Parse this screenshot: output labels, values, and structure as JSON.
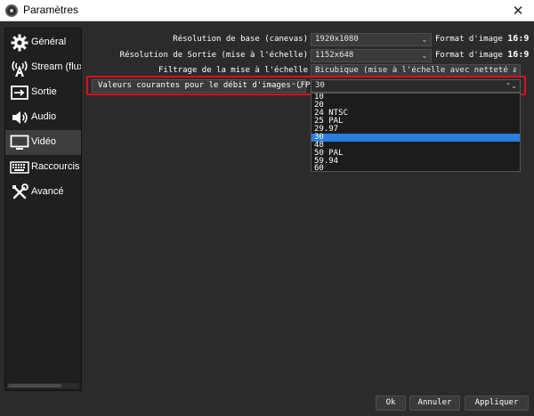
{
  "window": {
    "title": "Paramètres",
    "close_glyph": "✕"
  },
  "sidebar": {
    "items": [
      {
        "label": "Général",
        "icon": "gear-icon"
      },
      {
        "label": "Stream (flux)",
        "icon": "antenna-icon"
      },
      {
        "label": "Sortie",
        "icon": "output-icon"
      },
      {
        "label": "Audio",
        "icon": "speaker-icon"
      },
      {
        "label": "Vidéo",
        "icon": "monitor-icon",
        "active": true
      },
      {
        "label": "Raccourcis cl",
        "icon": "keyboard-icon"
      },
      {
        "label": "Avancé",
        "icon": "tools-icon"
      }
    ]
  },
  "video": {
    "base_resolution": {
      "label": "Résolution de base (canevas)",
      "value": "1920x1080",
      "aspect": "Format d'image",
      "aspect_value": "16:9"
    },
    "output_resolution": {
      "label": "Résolution de Sortie (mise à l'échelle)",
      "value": "1152x648",
      "aspect": "Format d'image",
      "aspect_value": "16:9"
    },
    "downscale_filter": {
      "label": "Filtrage de la mise à l'échelle",
      "value": "Bicubique (mise à l'échelle avec netteté acc"
    },
    "fps": {
      "type_label": "Valeurs courantes pour le débit d'images (FPS)",
      "value": "30",
      "options": [
        "10",
        "20",
        "24 NTSC",
        "25 PAL",
        "29.97",
        "30",
        "48",
        "50 PAL",
        "59.94",
        "60"
      ],
      "selected_index": 5
    }
  },
  "buttons": {
    "ok": "Ok",
    "cancel": "Annuler",
    "apply": "Appliquer"
  },
  "colors": {
    "highlight": "#d9101e",
    "selection": "#2a7ee0",
    "background": "#2b2b2b"
  }
}
